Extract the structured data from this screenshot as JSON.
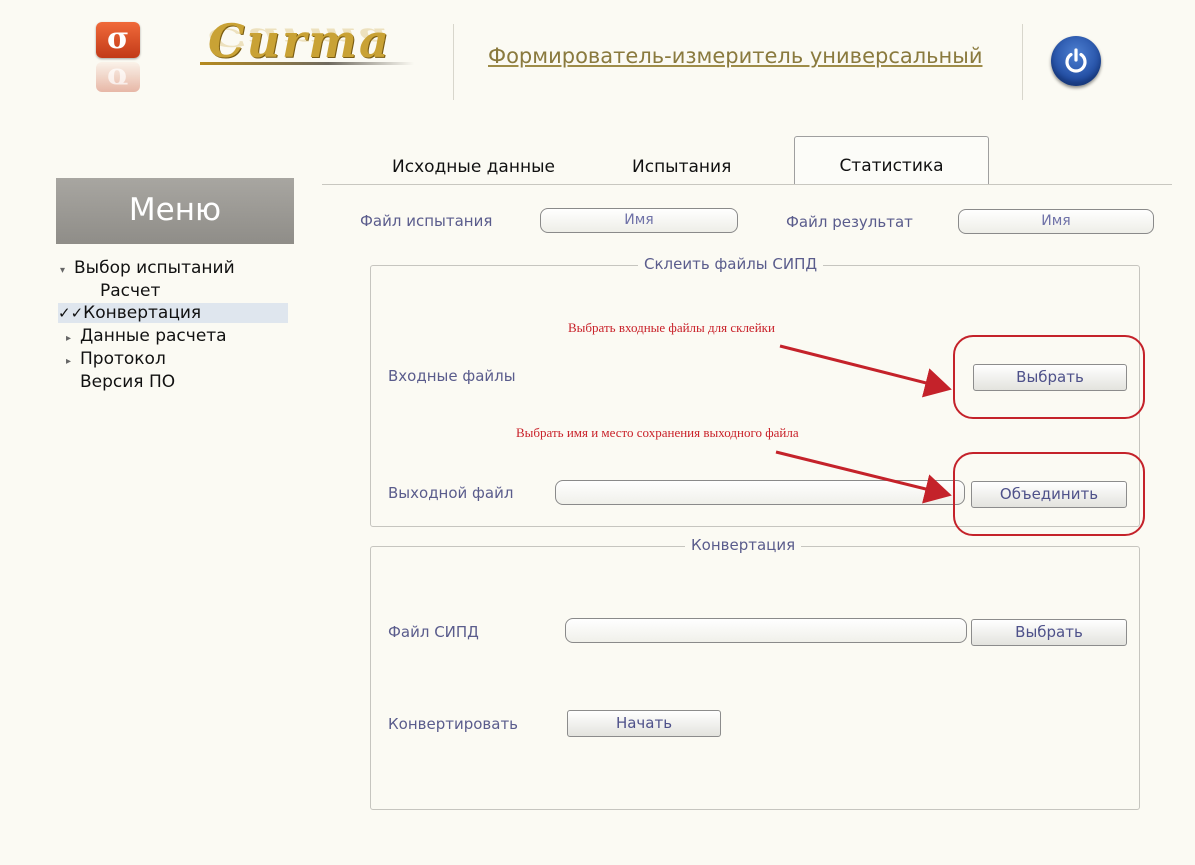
{
  "header": {
    "logo_glyph": "σ",
    "logo_text": "Curma",
    "subtitle": "Формирователь-измеритель универсальный"
  },
  "menu": {
    "title": "Меню",
    "items": [
      {
        "label": "Выбор испытаний",
        "marker": "▾"
      },
      {
        "label": "Расчет",
        "marker": ""
      },
      {
        "label": "Конвертация",
        "marker": "✓✓"
      },
      {
        "label": "Данные расчета",
        "marker": "▸"
      },
      {
        "label": "Протокол",
        "marker": "▸"
      },
      {
        "label": "Версия ПО",
        "marker": ""
      }
    ]
  },
  "tabs": {
    "items": [
      "Исходные данные",
      "Испытания",
      "Статистика"
    ],
    "active": "Статистика"
  },
  "file_row": {
    "test_file_label": "Файл испытания",
    "test_file_value": "Имя",
    "result_file_label": "Файл результат",
    "result_file_value": "Имя"
  },
  "merge_group": {
    "title": "Склеить файлы СИПД",
    "input_files_label": "Входные файлы",
    "select_button": "Выбрать",
    "output_file_label": "Выходной файл",
    "output_file_value": "",
    "merge_button": "Объединить"
  },
  "convert_group": {
    "title": "Конвертация",
    "sipd_file_label": "Файл СИПД",
    "sipd_file_value": "",
    "select_button": "Выбрать",
    "convert_label": "Конвертировать",
    "start_button": "Начать"
  },
  "annotations": {
    "note1": "Выбрать входные файлы для склейки",
    "note2": "Выбрать имя и место сохранения выходного файла",
    "color": "#c4222a"
  }
}
